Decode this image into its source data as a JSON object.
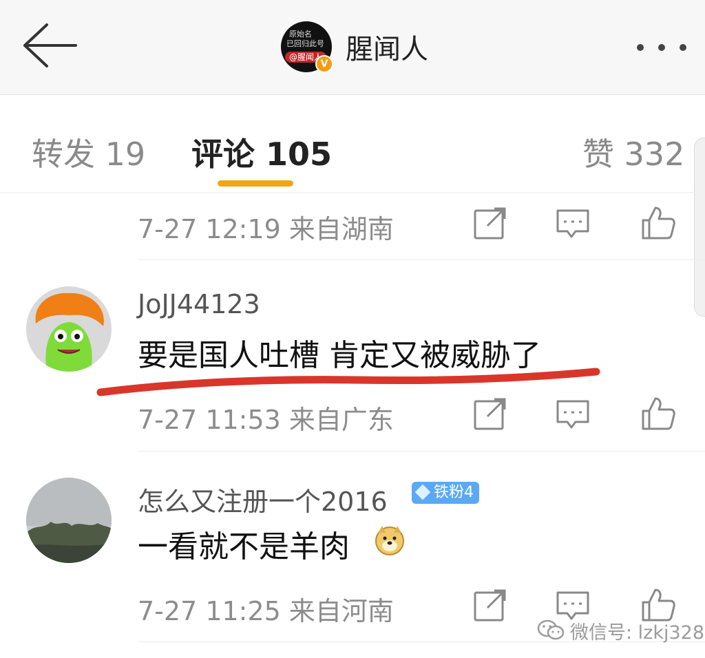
{
  "header": {
    "title": "腥闻人",
    "avatar_lines": [
      "原始名",
      "已回归此号",
      "@腥闻人"
    ],
    "verified_badge": "V",
    "back_icon": "back-arrow-icon",
    "more_icon": "more-dots-icon"
  },
  "tabs": {
    "repost": "转发 19",
    "comment": "评论 105",
    "like": "赞 332",
    "active": "comment",
    "accent": "#f2a515"
  },
  "comments": [
    {
      "meta": "7-27 12:19 来自湖南"
    },
    {
      "username": "JoJJ44123",
      "text": "要是国人吐槽 肯定又被威胁了",
      "meta": "7-27 11:53 来自广东",
      "underline_color": "#d9362b"
    },
    {
      "username": "怎么又注册一个2016",
      "badge": "铁粉4",
      "text": "一看就不是羊肉",
      "emoji": "doge-emoji",
      "meta": "7-27 11:25 来自河南"
    }
  ],
  "watermark": "微信号: lzkj328"
}
